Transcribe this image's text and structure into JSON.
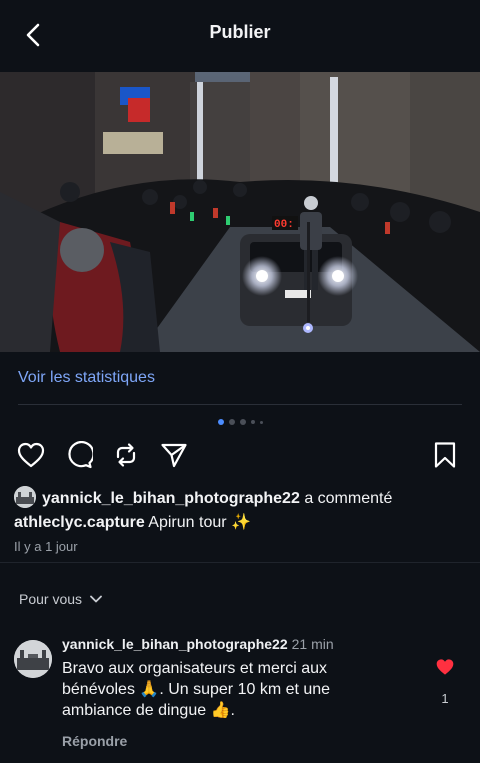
{
  "header": {
    "title": "Publier"
  },
  "stats_link": "Voir les statistiques",
  "carousel": {
    "count": 5,
    "active_index": 0
  },
  "notice": {
    "commenter": "yannick_le_bihan_photographe22",
    "action": "a commenté",
    "author": "athleclyc.capture",
    "caption": "Apirun tour ✨",
    "time": "Il y a 1 jour"
  },
  "sort": {
    "label": "Pour vous"
  },
  "comment": {
    "username": "yannick_le_bihan_photographe22",
    "time": "21 min",
    "text": "Bravo aux organisateurs et merci aux bénévoles 🙏. Un super 10 km et une ambiance de dingue 👍.",
    "reply_label": "Répondre",
    "likes": "1"
  },
  "photo_overlay": {
    "timer": "00:"
  },
  "colors": {
    "accent": "#7ea6f7",
    "like": "#ff3040",
    "dot_active": "#4c8dff",
    "background": "#0d1117"
  },
  "icons": [
    "back-icon",
    "user-icon",
    "heart-icon",
    "comment-icon",
    "repost-icon",
    "send-icon",
    "bookmark-icon",
    "chevron-down-icon"
  ]
}
